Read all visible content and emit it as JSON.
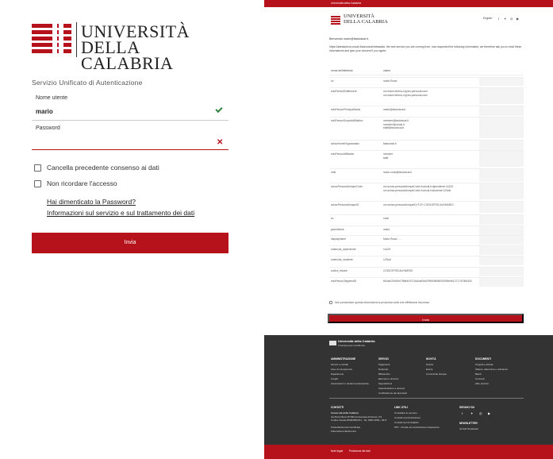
{
  "login": {
    "logo_line1": "UNIVERSITÀ",
    "logo_line2": "DELLA CALABRIA",
    "service_title": "Servizio Unificato di Autenticazione",
    "username_label": "Nome utente",
    "username_value": "mario",
    "password_label": "Password",
    "password_value": "",
    "clear_consent_label": "Cancella precedente consenso ai dati",
    "no_remember_label": "Non ricordare l'accesso",
    "forgot_link": "Hai dimenticato la Password?",
    "info_link": "Informazioni sul servizio e sul trattamento dei dati",
    "submit_label": "Invia",
    "colors": {
      "accent": "#b5121b",
      "ok": "#2e8540"
    }
  },
  "consent": {
    "topbar_text": "Università della Calabria",
    "logo_line1": "UNIVERSITÀ",
    "logo_line2": "DELLA CALABRIA",
    "language": "English",
    "social_icons": [
      "facebook-icon",
      "twitter-icon",
      "instagram-icon",
      "youtube-icon"
    ],
    "greeting": "Benvenuto mario@fastunical.it,",
    "intro": "https://attestazioni.unical.it/wa/unical/metadata. the web service you are coming from, has requested the following information; we therefore ask you to read these informations and give your consent if you agree.",
    "col_name": "nome dell'attributo",
    "col_value": "valore",
    "attributes": [
      {
        "name": "cn",
        "value": [
          "mario.Rossi"
        ]
      },
      {
        "name": "eduPersonEntitlement",
        "value": [
          "urn:mace:terena.org:tcs:personal-user",
          "urn:mace:terena.org:tcs:personal-user"
        ]
      },
      {
        "name": "eduPersonPrincipalName",
        "value": [
          "mario@fastunical.it"
        ]
      },
      {
        "name": "eduPersonScopedAffiliation",
        "value": [
          "member@fastunical.it",
          "member@unical.it",
          "staff@fastunical.it"
        ]
      },
      {
        "name": "schacHomeOrganization",
        "value": [
          "fastunical.it"
        ]
      },
      {
        "name": "eduPersonAffiliation",
        "value": [
          "member",
          "staff"
        ]
      },
      {
        "name": "mail",
        "value": [
          "mario.rossi@fastunical.it"
        ]
      },
      {
        "name": "schacPersonalUniqueCode",
        "value": [
          "urn:schac:personalUniqueCode:it:unical.it:dipendente:11425",
          "urn:schac:personalUniqueCode:it:unical.it:studente:123val"
        ]
      },
      {
        "name": "schacPersonalUniqueID",
        "value": [
          "urn:schac:personalUniqueID:IT:CF:CODICEFISCALEMARIO"
        ]
      },
      {
        "name": "sn",
        "value": [
          "rossi"
        ]
      },
      {
        "name": "givenName",
        "value": [
          "mario"
        ]
      },
      {
        "name": "displayName",
        "value": [
          "Mario Rossi - ..."
        ]
      },
      {
        "name": "matricola_dipendente",
        "value": [
          "11425"
        ]
      },
      {
        "name": "matricola_studente",
        "value": [
          "123val"
        ]
      },
      {
        "name": "codice_fiscale",
        "value": [
          "CODICEFISCALEMARIO"
        ]
      },
      {
        "name": "eduPersonTargetedID",
        "value": [
          "6f1ba0204f2e07f8fa4f1f7116a0a09dd7f90f0f8f06000090b9b1271747066430"
        ]
      }
    ],
    "remember_label": "Non presentare questa informativa la prossima volta che effettuerai l'accesso",
    "submit_label": "Invia",
    "footer": {
      "logo_name": "Università della Calabria",
      "logo_sub": "Il Campus per eccellenza",
      "cols": [
        {
          "title": "AMMINISTRAZIONE",
          "items": [
            "Servizi e contatti",
            "Aree di competenza",
            "Dipartimenti",
            "Luoghi",
            "Associazioni e studenti partecipante"
          ]
        },
        {
          "title": "SERVIZI",
          "items": [
            "Pagamenti",
            "Dottorato",
            "Biblioteche",
            "Elementi e tirocinio",
            "Segnalazioni",
            "Autenticazione e accessi",
            "Certificazione dei lavoratori"
          ]
        },
        {
          "title": "NOVITÀ",
          "items": [
            "Notizie",
            "Eventi",
            "Comunicati stampa"
          ]
        },
        {
          "title": "DOCUMENTI",
          "items": [
            "Progetti e attività",
            "Statuto, determine e ordinanze",
            "Bandi",
            "Concorsi",
            "Albo pretorio"
          ]
        }
      ],
      "contact_title": "CONTATTI",
      "contact_lines": [
        "Università della Calabria",
        "via Pietro Bucci 87036 Arcavacata di Rende, CS",
        "Codice Fiscale 80003650791 - Tel. 0984 4969 • 4917",
        "",
        "Posta Elettronica Certificata",
        "Fatturazione Elettronica"
      ],
      "links_title": "LINK UTILI",
      "links": [
        "Contattare le persone",
        "Contatti amministrazione",
        "Contatti servizi didattici",
        "PPT - Portale amministrazione trasparente"
      ],
      "follow_title": "SEGUICI SU",
      "newsletter_title": "NEWSLETTER",
      "newsletter_item": "Iscriviti Newsletter",
      "bottom_links": [
        "Note legali",
        "Protezione dei dati"
      ]
    }
  }
}
